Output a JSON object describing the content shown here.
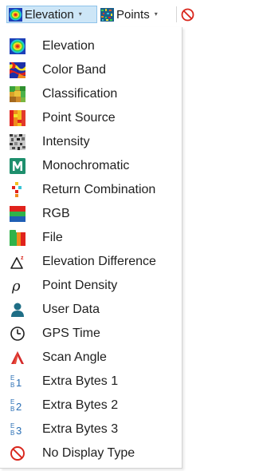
{
  "toolbar": {
    "display_type": {
      "label": "Elevation",
      "icon": "elevation-icon"
    },
    "render_type": {
      "label": "Points",
      "icon": "points-icon"
    },
    "no_display": {
      "icon": "no-display-icon"
    }
  },
  "menu": {
    "items": [
      {
        "label": "Elevation",
        "icon": "elevation-icon"
      },
      {
        "label": "Color Band",
        "icon": "color-band-icon"
      },
      {
        "label": "Classification",
        "icon": "classification-icon"
      },
      {
        "label": "Point Source",
        "icon": "point-source-icon"
      },
      {
        "label": "Intensity",
        "icon": "intensity-icon"
      },
      {
        "label": "Monochromatic",
        "icon": "monochromatic-icon"
      },
      {
        "label": "Return Combination",
        "icon": "return-combination-icon"
      },
      {
        "label": "RGB",
        "icon": "rgb-icon"
      },
      {
        "label": "File",
        "icon": "file-icon"
      },
      {
        "label": "Elevation Difference",
        "icon": "elevation-difference-icon"
      },
      {
        "label": "Point Density",
        "icon": "point-density-icon"
      },
      {
        "label": "User Data",
        "icon": "user-data-icon"
      },
      {
        "label": "GPS Time",
        "icon": "gps-time-icon"
      },
      {
        "label": "Scan Angle",
        "icon": "scan-angle-icon"
      },
      {
        "label": "Extra Bytes 1",
        "icon": "extra-bytes-1-icon"
      },
      {
        "label": "Extra Bytes 2",
        "icon": "extra-bytes-2-icon"
      },
      {
        "label": "Extra Bytes 3",
        "icon": "extra-bytes-3-icon"
      },
      {
        "label": "No Display Type",
        "icon": "no-display-type-icon"
      }
    ]
  },
  "colors": {
    "selected_background": "#cde6f7",
    "selected_border": "#8fc3ea",
    "no_display_red": "#d9261c",
    "monochrome_teal": "#1e8f6d",
    "user_data_teal": "#1f6e86",
    "scan_angle_red": "#d42a2a",
    "extra_bytes_blue": "#2a6fb5"
  }
}
